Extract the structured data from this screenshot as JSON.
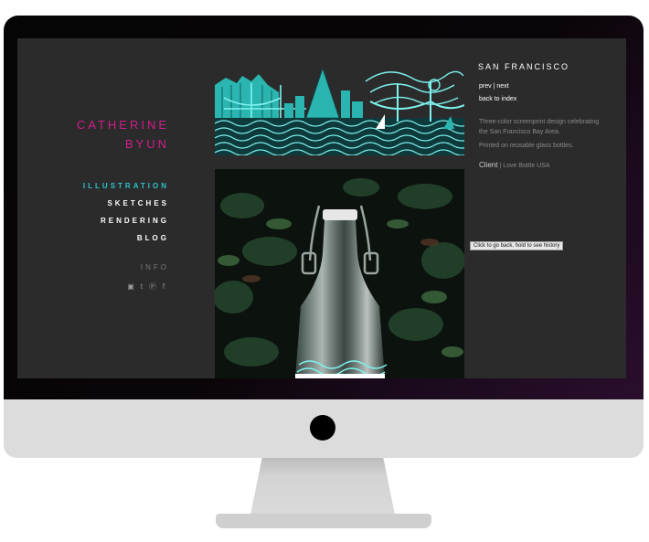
{
  "site": {
    "brand_line1": "CATHERINE",
    "brand_line2": "BYUN",
    "nav": [
      "ILLUSTRATION",
      "SKETCHES",
      "RENDERING",
      "BLOG"
    ],
    "active_nav": "ILLUSTRATION",
    "info_label": "INFO",
    "social_icons": [
      "instagram-icon",
      "tumblr-icon",
      "pinterest-icon",
      "facebook-icon"
    ]
  },
  "project": {
    "title": "SAN FRANCISCO",
    "prev": "prev",
    "separator": "|",
    "next": "next",
    "back": "back to index",
    "description": "Three-color screenprint design celebrating the San Francisco Bay Area.",
    "printed": "Printed on reusable glass bottles.",
    "client_label": "Client",
    "client_sep": "|",
    "client_name": "Love Bottle USA"
  },
  "tooltip": "Click to go back, hold to see history",
  "colors": {
    "brand": "#d21c8c",
    "accent": "#2cc3c9",
    "screen_bg": "#2b2b2b"
  }
}
